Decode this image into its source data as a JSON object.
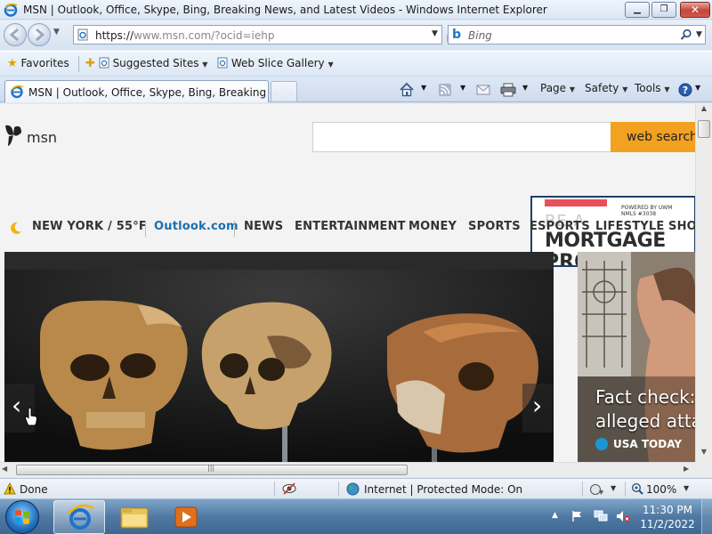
{
  "window": {
    "title": "MSN | Outlook, Office, Skype, Bing, Breaking News, and Latest Videos - Windows Internet Explorer"
  },
  "navbar": {
    "address_scheme": "https://",
    "address_domain": "www.msn.com",
    "address_path": "/?ocid=iehp",
    "search_placeholder": "Bing"
  },
  "favorites_bar": {
    "favorites": "Favorites",
    "suggested_sites": "Suggested Sites",
    "web_slice_gallery": "Web Slice Gallery"
  },
  "tabs": [
    {
      "title": "MSN | Outlook, Office, Skype, Bing, Breaking Ne..."
    }
  ],
  "command_bar": {
    "page": "Page",
    "safety": "Safety",
    "tools": "Tools"
  },
  "page": {
    "logo_text": "msn",
    "search_button": "web search",
    "weather": "NEW YORK / 55°F",
    "nav": [
      "Outlook.com",
      "NEWS",
      "ENTERTAINMENT",
      "MONEY",
      "SPORTS",
      "ESPORTS",
      "LIFESTYLE",
      "SHO"
    ],
    "ad": {
      "line1": "BE A",
      "line2": "MORTGAGE",
      "line3": "PRO",
      "powered": "POWERED BY UWM NMLS #3038"
    },
    "side_card": {
      "headline_line1": "Fact check: Pa",
      "headline_line2": "alleged attac",
      "source": "USA TODAY"
    }
  },
  "statusbar": {
    "status": "Done",
    "zone": "Internet | Protected Mode: On",
    "zoom": "100%"
  },
  "taskbar": {
    "time": "11:30 PM",
    "date": "11/2/2022"
  }
}
